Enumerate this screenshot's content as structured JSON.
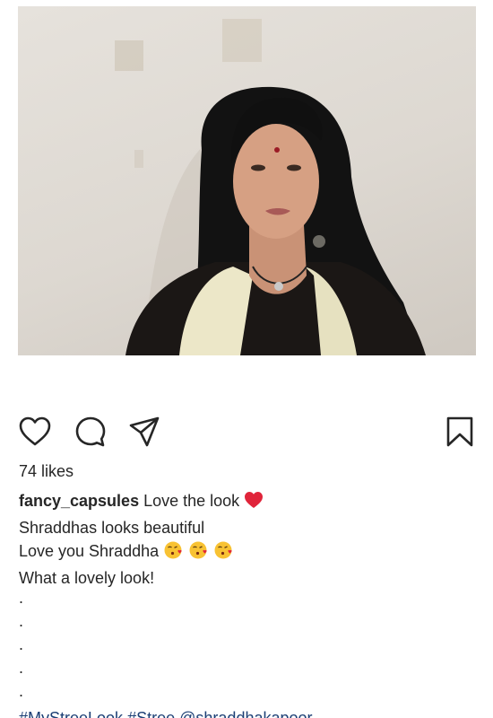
{
  "post": {
    "photo_alt": "",
    "likes_text": "74 likes",
    "username": "fancy_capsules",
    "caption_lines": {
      "l1": "Love the look",
      "l2": "Shraddhas looks beautiful",
      "l3": "Love you Shraddha",
      "l4": "What a lovely look!"
    },
    "dots": [
      ".",
      ".",
      ".",
      ".",
      "."
    ],
    "hashtags": {
      "t1": "#MyStreeLook",
      "t2": "#Stree",
      "t3": "@shraddhakapoor"
    },
    "icons": {
      "like": "heart-outline-icon",
      "comment": "comment-bubble-icon",
      "share": "paper-plane-icon",
      "save": "bookmark-outline-icon",
      "caption_heart": "red-heart-emoji",
      "kiss": "face-blowing-kiss-emoji"
    },
    "colors": {
      "text": "#262626",
      "hashtag": "#1c3f75",
      "heart": "#e0243a",
      "emoji_face": "#f8c233"
    }
  }
}
